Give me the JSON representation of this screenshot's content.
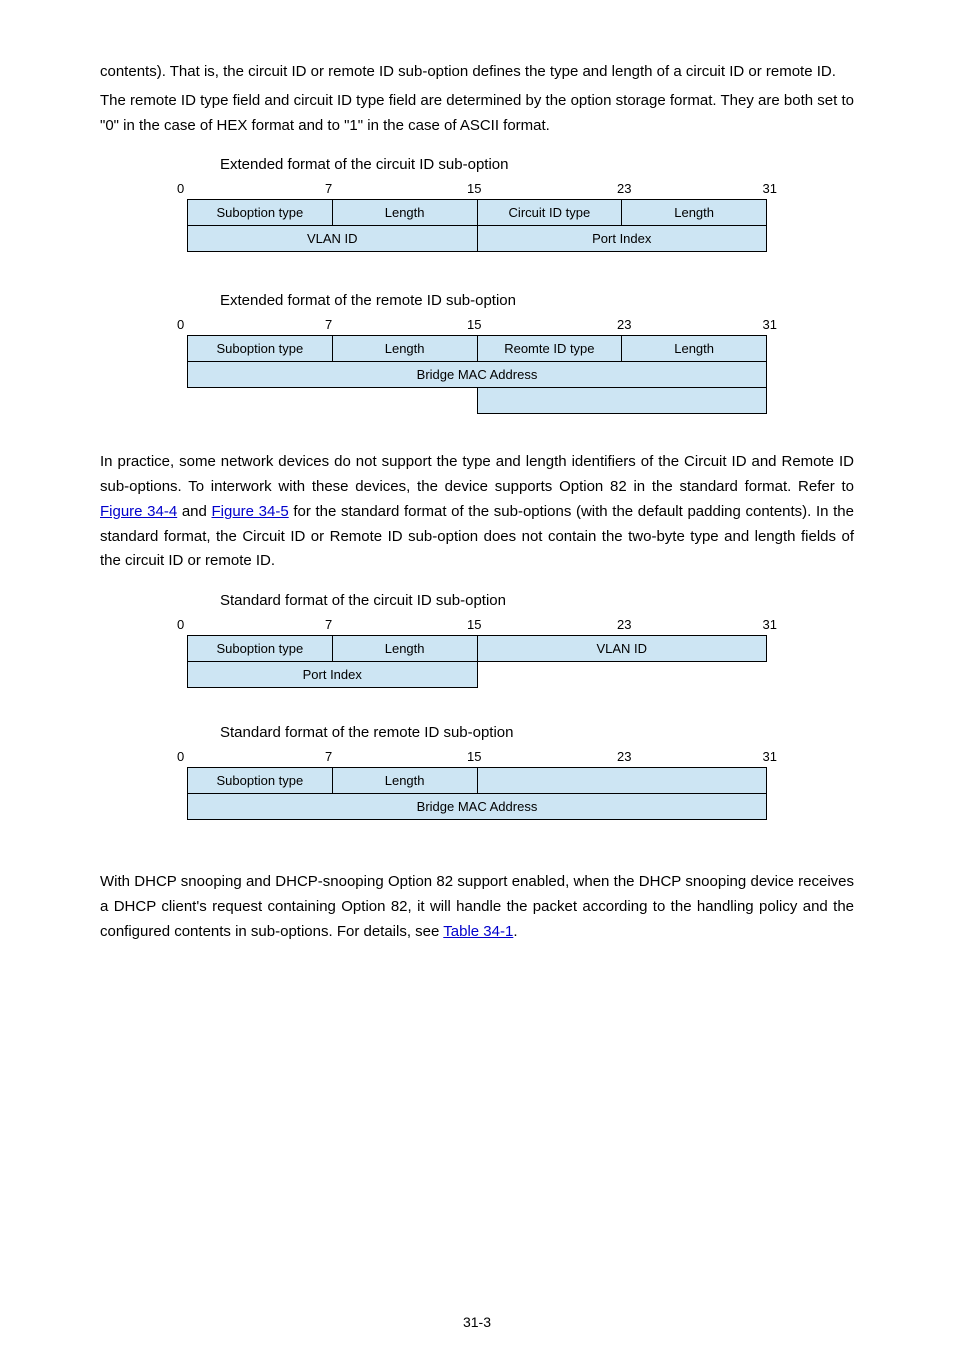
{
  "paragraphs": {
    "p1a": "contents). That is, the circuit ID or remote ID sub-option defines the type and length of a circuit ID or remote ID.",
    "p1b": "The remote ID type field and circuit ID type field are determined by the option storage format. They are both set to \"0\" in the case of HEX format and to \"1\" in the case of ASCII format.",
    "p2a": "In practice, some network devices do not support the type and length identifiers of the Circuit ID and Remote ID sub-options. To interwork with these devices, the device supports Option 82 in the standard format. Refer to ",
    "p2link1": "Figure 34-4",
    "p2mid": " and ",
    "p2link2": "Figure 34-5",
    "p2b": " for the standard format of the sub-options (with the default padding contents). In the standard format, the Circuit ID or Remote ID sub-option does not contain the two-byte type and length fields of the circuit ID or remote ID.",
    "p3a": "With DHCP snooping and DHCP-snooping Option 82 support enabled, when the DHCP snooping device receives a DHCP client's request containing Option 82, it will handle the packet according to the handling policy and the configured contents in sub-options. For details, see ",
    "p3link": "Table 34-1",
    "p3b": "."
  },
  "captions": {
    "c1": "Extended format of the circuit ID sub-option",
    "c2": "Extended format of the remote ID sub-option",
    "c3": "Standard format of the circuit ID sub-option",
    "c4": "Standard format of the remote ID sub-option"
  },
  "ruler_labels": {
    "l0": "0",
    "l7": "7",
    "l15": "15",
    "l23": "23",
    "l31": "31"
  },
  "fields": {
    "suboption_type": "Suboption type",
    "length": "Length",
    "circuit_id_type": "Circuit ID type",
    "remote_id_type": "Reomte ID type",
    "vlan_id": "VLAN ID",
    "port_index": "Port Index",
    "bridge_mac": "Bridge MAC Address"
  },
  "page_number": "31-3"
}
